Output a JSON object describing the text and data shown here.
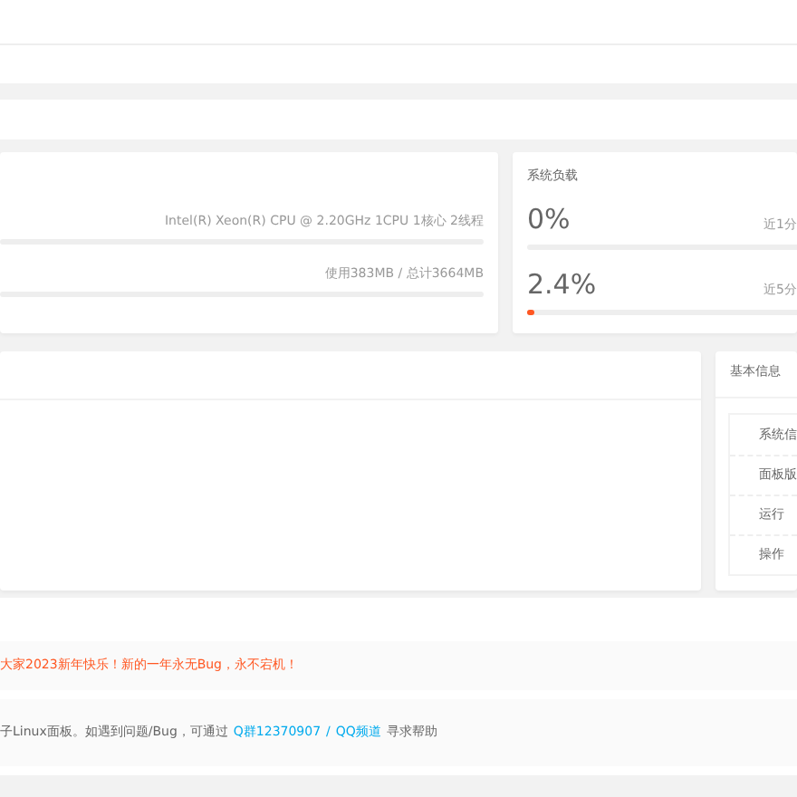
{
  "cpu_card": {
    "cpu_model": "Intel(R) Xeon(R) CPU @ 2.20GHz 1CPU 1核心 2线程",
    "memory": "使用383MB / 总计3664MB"
  },
  "load_card": {
    "title": "系统负载",
    "items": [
      {
        "value": "0%",
        "period": "近1分"
      },
      {
        "value": "2.4%",
        "period": "近5分",
        "level": 0.024
      }
    ]
  },
  "basic_info": {
    "title": "基本信息",
    "rows": [
      "系统信",
      "面板版",
      "运行",
      "操作"
    ]
  },
  "notice": "大家2023新年快乐！新的一年永无Bug，永不宕机！",
  "footer": {
    "text": "子Linux面板。如遇到问题/Bug，可通过",
    "links": [
      {
        "label": "Q群12370907"
      },
      {
        "label": "QQ频道"
      }
    ],
    "separator": "/",
    "tail": "寻求帮助"
  }
}
